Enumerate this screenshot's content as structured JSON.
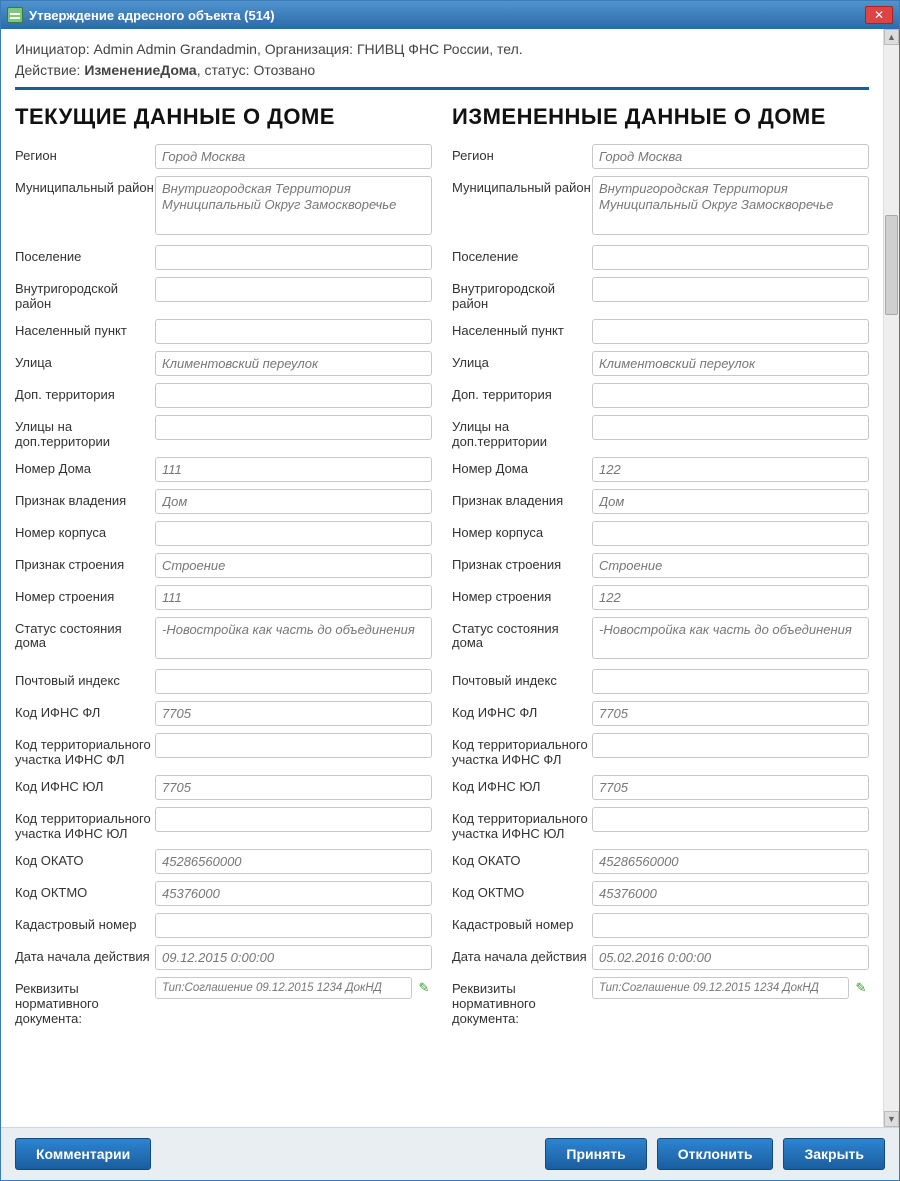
{
  "window": {
    "title": "Утверждение адресного объекта (514)",
    "close_glyph": "✕"
  },
  "meta": {
    "line1_prefix": "Инициатор: ",
    "initiator": "Admin Admin Grandadmin",
    "org_prefix": ", Организация: ",
    "organization": "ГНИВЦ ФНС России",
    "tel_prefix": ", тел.",
    "line2_prefix": "Действие: ",
    "action": "ИзменениеДома",
    "status_prefix": ", статус: ",
    "status": "Отозвано"
  },
  "headings": {
    "current": "ТЕКУЩИЕ ДАННЫЕ О ДОМЕ",
    "changed": "ИЗМЕНЕННЫЕ ДАННЫЕ О ДОМЕ"
  },
  "labels": {
    "region": "Регион",
    "municipal": "Муниципальный район",
    "settlement": "Поселение",
    "inner_city": "Внутригородской район",
    "locality": "Населенный пункт",
    "street": "Улица",
    "add_territory": "Доп. территория",
    "streets_on_add": "Улицы на доп.территории",
    "house_no": "Номер Дома",
    "ownership_sign": "Признак владения",
    "building_no": "Номер корпуса",
    "structure_sign": "Признак строения",
    "structure_no": "Номер строения",
    "house_status": "Статус состояния дома",
    "postal": "Почтовый индекс",
    "ifns_fl": "Код ИФНС ФЛ",
    "terr_ifns_fl": "Код территориального участка ИФНС ФЛ",
    "ifns_ul": "Код ИФНС ЮЛ",
    "terr_ifns_ul": "Код территориального участка ИФНС ЮЛ",
    "okato": "Код ОКАТО",
    "oktmo": "Код ОКТМО",
    "cadastral": "Кадастровый номер",
    "start_date": "Дата начала действия",
    "doc_req": "Реквизиты нормативного документа:"
  },
  "current": {
    "region": "Город Москва",
    "municipal": "Внутригородская Территория Муниципальный Округ Замоскворечье",
    "settlement": "",
    "inner_city": "",
    "locality": "",
    "street": "Климентовский переулок",
    "add_territory": "",
    "streets_on_add": "",
    "house_no": "111",
    "ownership_sign": "Дом",
    "building_no": "",
    "structure_sign": "Строение",
    "structure_no": "111",
    "house_status": "-Новостройка как часть до объединения",
    "postal": "",
    "ifns_fl": "7705",
    "terr_ifns_fl": "",
    "ifns_ul": "7705",
    "terr_ifns_ul": "",
    "okato": "45286560000",
    "oktmo": "45376000",
    "cadastral": "",
    "start_date": "09.12.2015 0:00:00",
    "doc_req": "Тип:Соглашение 09.12.2015 1234 ДокНД"
  },
  "changed": {
    "region": "Город Москва",
    "municipal": "Внутригородская Территория Муниципальный Округ Замоскворечье",
    "settlement": "",
    "inner_city": "",
    "locality": "",
    "street": "Климентовский переулок",
    "add_territory": "",
    "streets_on_add": "",
    "house_no": "122",
    "ownership_sign": "Дом",
    "building_no": "",
    "structure_sign": "Строение",
    "structure_no": "122",
    "house_status": "-Новостройка как часть до объединения",
    "postal": "",
    "ifns_fl": "7705",
    "terr_ifns_fl": "",
    "ifns_ul": "7705",
    "terr_ifns_ul": "",
    "okato": "45286560000",
    "oktmo": "45376000",
    "cadastral": "",
    "start_date": "05.02.2016 0:00:00",
    "doc_req": "Тип:Соглашение 09.12.2015 1234 ДокНД"
  },
  "footer": {
    "comments": "Комментарии",
    "accept": "Принять",
    "reject": "Отклонить",
    "close": "Закрыть"
  },
  "icons": {
    "edit": "✎"
  }
}
